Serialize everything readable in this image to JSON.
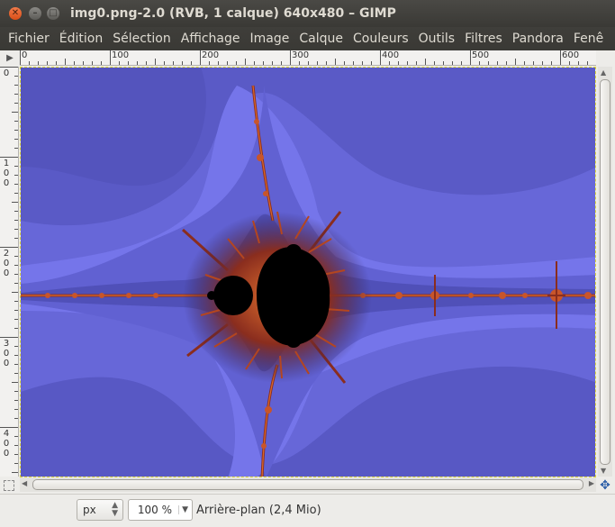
{
  "window": {
    "title": "img0.png-2.0 (RVB, 1 calque) 640x480 – GIMP",
    "close_glyph": "✕",
    "minimize_glyph": "–",
    "maximize_glyph": "□"
  },
  "menubar": {
    "items": [
      "Fichier",
      "Édition",
      "Sélection",
      "Affichage",
      "Image",
      "Calque",
      "Couleurs",
      "Outils",
      "Filtres",
      "Pandora",
      "Fenê"
    ]
  },
  "rulers": {
    "horizontal_labels": [
      "0",
      "100",
      "200",
      "300",
      "400",
      "500",
      "600"
    ],
    "vertical_labels": [
      "0",
      "100",
      "200",
      "300",
      "400"
    ]
  },
  "statusbar": {
    "unit": "px",
    "zoom": "100 %",
    "layer_info": "Arrière-plan (2,4 Mio)"
  },
  "icons": {
    "nav_corner": "pointer-menu-icon",
    "navigate": "navigate-icon",
    "quick_mask": "quick-mask-icon"
  },
  "colors": {
    "titlebar": "#3c3b37",
    "fractal_background": "#6a6adf",
    "fractal_set": "#000000",
    "fractal_glow": "#c8552a"
  }
}
